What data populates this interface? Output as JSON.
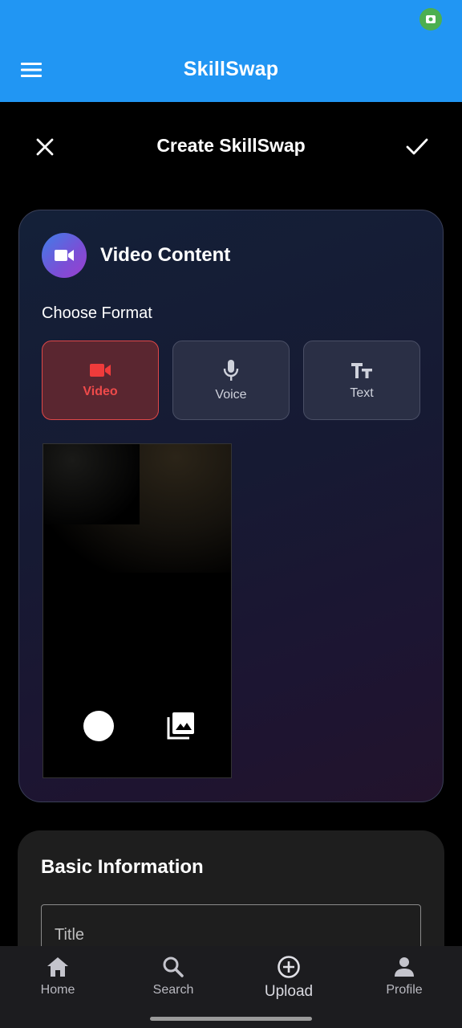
{
  "app_bar": {
    "title": "SkillSwap"
  },
  "header": {
    "title": "Create SkillSwap"
  },
  "video_card": {
    "title": "Video Content",
    "choose_format_label": "Choose Format",
    "formats": [
      {
        "label": "Video",
        "icon": "videocam-icon",
        "selected": true
      },
      {
        "label": "Voice",
        "icon": "mic-icon",
        "selected": false
      },
      {
        "label": "Text",
        "icon": "text-fields-icon",
        "selected": false
      }
    ]
  },
  "basic_info": {
    "title": "Basic Information",
    "title_field_placeholder": "Title"
  },
  "bottom_nav": {
    "items": [
      {
        "label": "Home",
        "icon": "home-icon"
      },
      {
        "label": "Search",
        "icon": "search-icon"
      },
      {
        "label": "Upload",
        "icon": "add-circle-icon"
      },
      {
        "label": "Profile",
        "icon": "person-icon"
      }
    ]
  },
  "colors": {
    "app_bar": "#2196F3",
    "selected_format": "#E04848",
    "status_indicator": "#4CAF50"
  }
}
